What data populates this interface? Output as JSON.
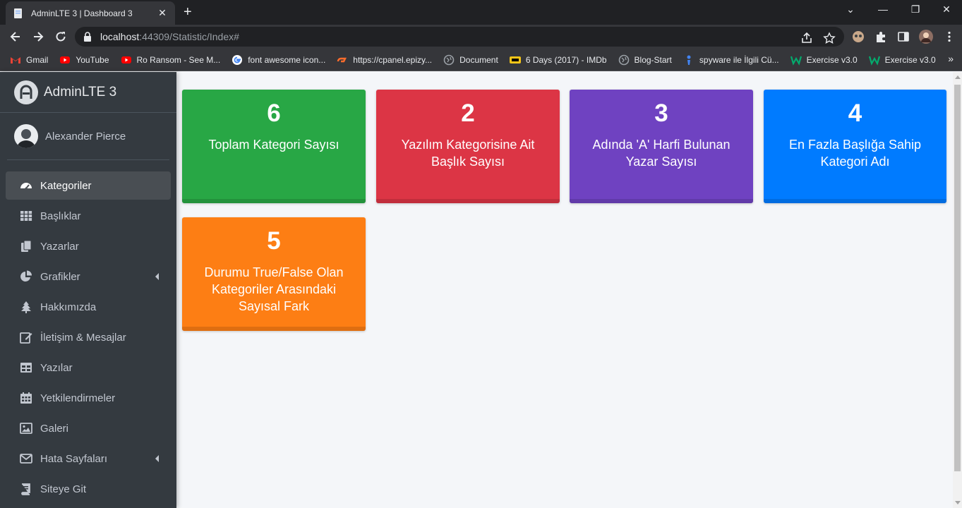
{
  "browser": {
    "tab_title": "AdminLTE 3 | Dashboard 3",
    "tab_close": "✕",
    "new_tab": "+",
    "url_host": "localhost",
    "url_path": ":44309/Statistic/Index#",
    "window_controls": {
      "minimize": "—",
      "restore": "❐",
      "close": "✕",
      "tabs_menu": "⌄"
    },
    "bookmarks": [
      {
        "label": "Gmail",
        "icon": "gmail-icon",
        "color": "#ea4335"
      },
      {
        "label": "YouTube",
        "icon": "youtube-icon",
        "color": "#ff0000"
      },
      {
        "label": "Ro Ransom - See M...",
        "icon": "youtube-icon",
        "color": "#ff0000"
      },
      {
        "label": "font awesome icon...",
        "icon": "google-icon",
        "color": "#ffffff"
      },
      {
        "label": "https://cpanel.epizy...",
        "icon": "cpanel-icon",
        "color": "#ff6c2c"
      },
      {
        "label": "Document",
        "icon": "globe-icon",
        "color": "#9aa0a6"
      },
      {
        "label": "6 Days (2017) - IMDb",
        "icon": "imdb-icon",
        "color": "#f5c518"
      },
      {
        "label": "Blog-Start",
        "icon": "globe-icon",
        "color": "#9aa0a6"
      },
      {
        "label": "spyware ile İlgili Cü...",
        "icon": "person-icon",
        "color": "#4285f4"
      },
      {
        "label": "Exercise v3.0",
        "icon": "w3schools-icon",
        "color": "#04aa6d"
      },
      {
        "label": "Exercise v3.0",
        "icon": "w3schools-icon",
        "color": "#04aa6d"
      }
    ],
    "bookmarks_more": "»"
  },
  "sidebar": {
    "brand": "AdminLTE 3",
    "user": "Alexander Pierce",
    "items": [
      {
        "label": "Kategoriler",
        "icon": "tachometer-icon",
        "active": true,
        "chevron": false
      },
      {
        "label": "Başlıklar",
        "icon": "th-icon",
        "active": false,
        "chevron": false
      },
      {
        "label": "Yazarlar",
        "icon": "copy-icon",
        "active": false,
        "chevron": false
      },
      {
        "label": "Grafikler",
        "icon": "chart-pie-icon",
        "active": false,
        "chevron": true
      },
      {
        "label": "Hakkımızda",
        "icon": "tree-icon",
        "active": false,
        "chevron": false
      },
      {
        "label": "İletişim & Mesajlar",
        "icon": "edit-icon",
        "active": false,
        "chevron": false
      },
      {
        "label": "Yazılar",
        "icon": "table-icon",
        "active": false,
        "chevron": false
      },
      {
        "label": "Yetkilendirmeler",
        "icon": "calendar-icon",
        "active": false,
        "chevron": false
      },
      {
        "label": "Galeri",
        "icon": "image-icon",
        "active": false,
        "chevron": false
      },
      {
        "label": "Hata Sayfaları",
        "icon": "envelope-icon",
        "active": false,
        "chevron": true
      },
      {
        "label": "Siteye Git",
        "icon": "book-icon",
        "active": false,
        "chevron": false
      }
    ]
  },
  "stats": [
    {
      "value": "6",
      "label": "Toplam Kategori Sayısı",
      "color": "#28a745"
    },
    {
      "value": "2",
      "label": "Yazılım Kategorisine Ait Başlık Sayısı",
      "color": "#dc3545"
    },
    {
      "value": "3",
      "label": "Adında 'A' Harfi Bulunan Yazar Sayısı",
      "color": "#6f42c1"
    },
    {
      "value": "4",
      "label": "En Fazla Başlığa Sahip Kategori Adı",
      "color": "#007bff"
    },
    {
      "value": "5",
      "label": "Durumu True/False Olan Kategoriler Arasındaki Sayısal Fark",
      "color": "#fd7e14"
    }
  ]
}
